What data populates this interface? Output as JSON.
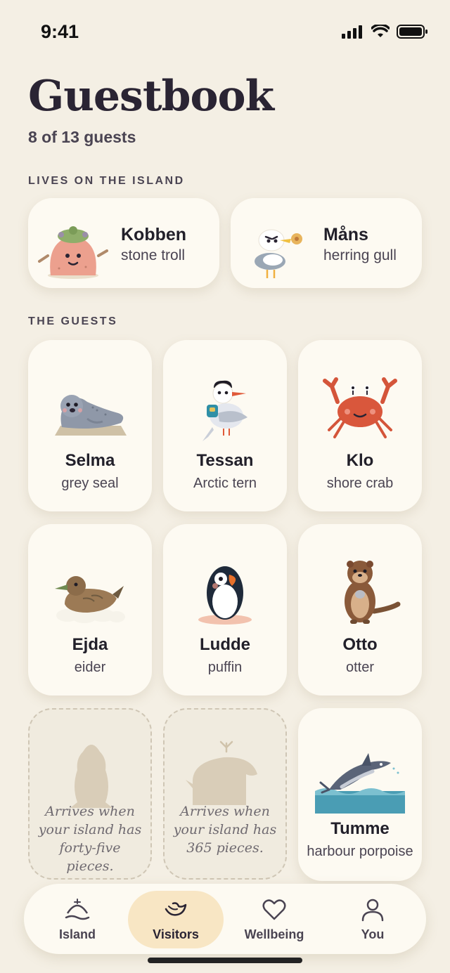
{
  "status": {
    "time": "9:41"
  },
  "header": {
    "title": "Guestbook",
    "subtitle": "8 of 13 guests"
  },
  "sections": {
    "residents_label": "LIVES ON THE ISLAND",
    "guests_label": "THE GUESTS"
  },
  "residents": [
    {
      "name": "Kobben",
      "kind": "stone troll",
      "icon": "stone-troll-icon"
    },
    {
      "name": "Måns",
      "kind": "herring gull",
      "icon": "herring-gull-icon"
    }
  ],
  "guests": [
    {
      "name": "Selma",
      "kind": "grey seal",
      "icon": "grey-seal-icon"
    },
    {
      "name": "Tessan",
      "kind": "Arctic tern",
      "icon": "arctic-tern-icon"
    },
    {
      "name": "Klo",
      "kind": "shore crab",
      "icon": "shore-crab-icon"
    },
    {
      "name": "Ejda",
      "kind": "eider",
      "icon": "eider-icon"
    },
    {
      "name": "Ludde",
      "kind": "puffin",
      "icon": "puffin-icon"
    },
    {
      "name": "Otto",
      "kind": "otter",
      "icon": "otter-icon"
    },
    {
      "name": "Tumme",
      "kind": "harbour porpoise",
      "icon": "harbour-porpoise-icon"
    }
  ],
  "locked": [
    {
      "message": "Arrives when your island has forty-five pieces.",
      "icon": "owl-silhouette-icon"
    },
    {
      "message": "Arrives when your island has 365 pieces.",
      "icon": "whale-silhouette-icon"
    }
  ],
  "tabs": [
    {
      "label": "Island",
      "icon": "island-icon",
      "active": false
    },
    {
      "label": "Visitors",
      "icon": "bird-icon",
      "active": true
    },
    {
      "label": "Wellbeing",
      "icon": "heart-icon",
      "active": false
    },
    {
      "label": "You",
      "icon": "person-icon",
      "active": false
    }
  ],
  "colors": {
    "background": "#f4efe4",
    "card": "#fdfaf2",
    "active_tab": "#f8e6c4",
    "text": "#26222e"
  }
}
